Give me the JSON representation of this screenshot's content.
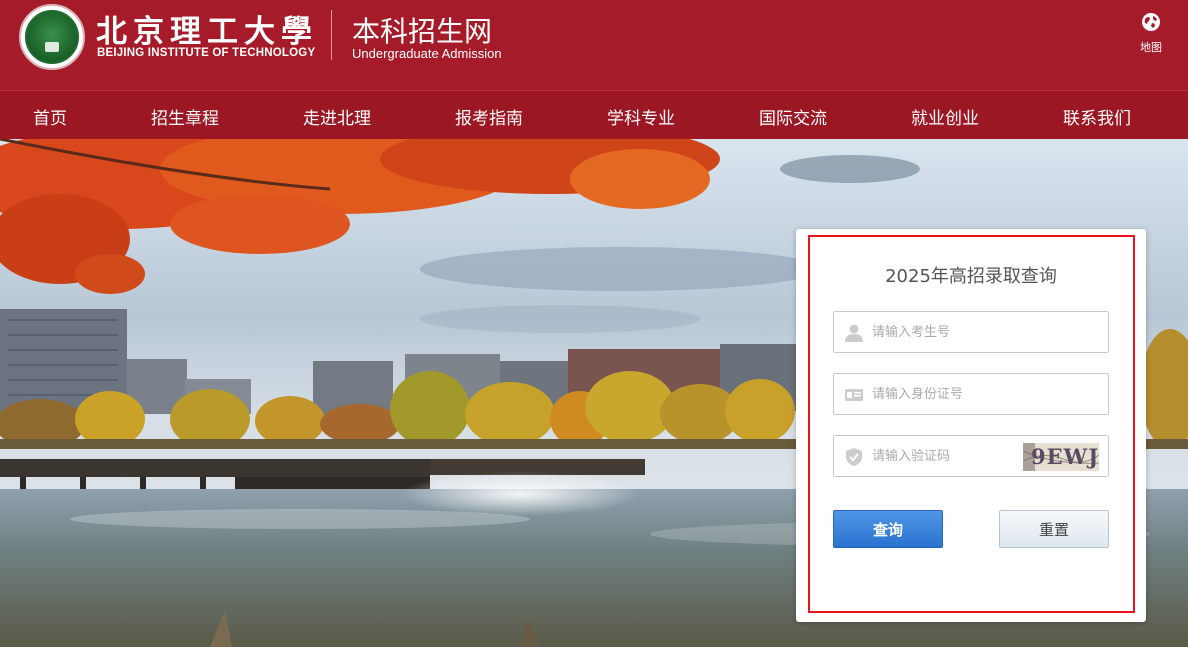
{
  "header": {
    "brand_cn": "北京理工大學",
    "brand_en": "BEIJING INSTITUTE OF TECHNOLOGY",
    "site_cn": "本科招生网",
    "site_en": "Undergraduate Admission",
    "map_label": "地图",
    "map_icon": "globe-icon"
  },
  "nav": {
    "items": [
      {
        "label": "首页"
      },
      {
        "label": "招生章程"
      },
      {
        "label": "走进北理"
      },
      {
        "label": "报考指南"
      },
      {
        "label": "学科专业"
      },
      {
        "label": "国际交流"
      },
      {
        "label": "就业创业"
      },
      {
        "label": "联系我们"
      }
    ]
  },
  "query_form": {
    "title": "2025年高招录取查询",
    "candidate_no": {
      "placeholder": "请输入考生号",
      "value": "",
      "icon": "user-icon"
    },
    "id_no": {
      "placeholder": "请输入身份证号",
      "value": "",
      "icon": "id-card-icon"
    },
    "captcha": {
      "placeholder": "请输入验证码",
      "value": "",
      "icon": "shield-icon",
      "image_text": "9EWJ"
    },
    "query_label": "查询",
    "reset_label": "重置"
  },
  "colors": {
    "header_bg": "#a61b29",
    "nav_bg": "#9c1724",
    "query_button": "#2a72cf",
    "highlight_border": "#e8161c"
  }
}
